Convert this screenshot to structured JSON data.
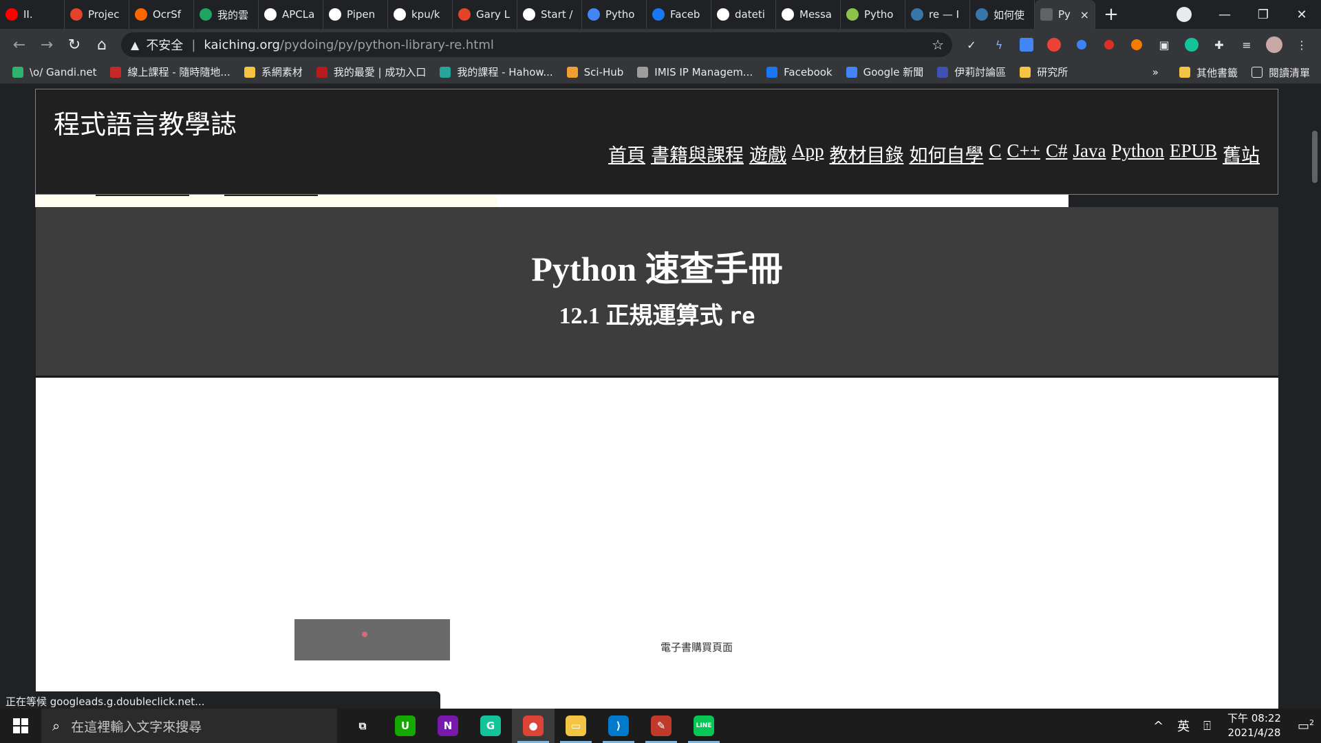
{
  "browser": {
    "tabs": [
      {
        "label": "II.",
        "icon": "youtube-icon",
        "color": "#ff0000"
      },
      {
        "label": "Projec",
        "icon": "gitlab-icon",
        "color": "#e24329"
      },
      {
        "label": "OcrSf",
        "icon": "sourceforge-icon",
        "color": "#ff6600"
      },
      {
        "label": "我的雲",
        "icon": "google-drive-icon",
        "color": "#1fa463"
      },
      {
        "label": "APCLa",
        "icon": "github-icon",
        "color": "#ffffff"
      },
      {
        "label": "Pipen",
        "icon": "medium-icon",
        "color": "#ffffff"
      },
      {
        "label": "kpu/k",
        "icon": "github-icon",
        "color": "#ffffff"
      },
      {
        "label": "Gary L",
        "icon": "gitlab-icon",
        "color": "#e24329"
      },
      {
        "label": "Start /",
        "icon": "start-icon",
        "color": "#ffffff"
      },
      {
        "label": "Pytho",
        "icon": "codegrepper-icon",
        "color": "#4285f4"
      },
      {
        "label": "Faceb",
        "icon": "facebook-icon",
        "color": "#1877f2"
      },
      {
        "label": "dateti",
        "icon": "google-icon",
        "color": "#ffffff"
      },
      {
        "label": "Messa",
        "icon": "google-icon",
        "color": "#ffffff"
      },
      {
        "label": "Pytho",
        "icon": "python-icon",
        "color": "#8bc34a"
      },
      {
        "label": "re — I",
        "icon": "python-icon",
        "color": "#3776ab"
      },
      {
        "label": "如何使",
        "icon": "python-icon",
        "color": "#3776ab"
      }
    ],
    "active_tab": {
      "label": "Py",
      "close": "×"
    },
    "new_tab": "+",
    "window": {
      "minimize": "—",
      "restore": "❐",
      "close": "✕"
    },
    "address": {
      "security_label": "不安全",
      "separator": "|",
      "host": "kaiching.org",
      "path": "/pydoing/py/python-library-re.html"
    },
    "bookmarks": [
      {
        "label": "\\o/ Gandi.net",
        "color": "#2fb26b"
      },
      {
        "label": "線上課程 - 隨時隨地...",
        "color": "#c62828"
      },
      {
        "label": "系網素材",
        "color": "#f6c342"
      },
      {
        "label": "我的最愛 | 成功入口",
        "color": "#b71c1c"
      },
      {
        "label": "我的課程 - Hahow...",
        "color": "#26a69a"
      },
      {
        "label": "Sci-Hub",
        "color": "#f0a030"
      },
      {
        "label": "IMIS IP Managem...",
        "color": "#9e9e9e"
      },
      {
        "label": "Facebook",
        "color": "#1877f2"
      },
      {
        "label": "Google 新聞",
        "color": "#4285f4"
      },
      {
        "label": "伊莉討論區",
        "color": "#3f51b5"
      },
      {
        "label": "研究所",
        "color": "#f6c342"
      }
    ],
    "bookmarks_more": "»",
    "other_bookmarks": "其他書籤",
    "reading_list": "閱讀清單",
    "status_text": "正在等候 googleads.g.doubleclick.net..."
  },
  "page": {
    "site_title": "程式語言教學誌",
    "nav": [
      "首頁",
      "書籍與課程",
      "遊戲",
      "App",
      "教材目錄",
      "如何自學",
      "C",
      "C++",
      "C#",
      "Java",
      "Python",
      "EPUB",
      "舊站"
    ],
    "hero_title": "Python 速查手冊",
    "hero_subtitle_prefix": "12.1 正規運算式 ",
    "hero_subtitle_code": "re",
    "ebook_text": "電子書購買頁面"
  },
  "taskbar": {
    "search_placeholder": "在這裡輸入文字來搜尋",
    "apps": [
      {
        "name": "task-view",
        "label": "⧉",
        "color": "transparent"
      },
      {
        "name": "upwork",
        "label": "U",
        "color": "#14a800"
      },
      {
        "name": "onenote",
        "label": "N",
        "color": "#7719aa"
      },
      {
        "name": "grammarly",
        "label": "G",
        "color": "#15c39a"
      },
      {
        "name": "chrome",
        "label": "●",
        "color": "#db4437"
      },
      {
        "name": "file-explorer",
        "label": "▭",
        "color": "#f4c542"
      },
      {
        "name": "vscode",
        "label": "⟩",
        "color": "#007acc"
      },
      {
        "name": "pen-app",
        "label": "✎",
        "color": "#c0392b"
      },
      {
        "name": "line",
        "label": "LINE",
        "color": "#06c755"
      }
    ],
    "tray": {
      "chevron": "^",
      "ime": "英",
      "ime_mode": "⍐",
      "time": "下午 08:22",
      "date": "2021/4/28",
      "notifications": "2"
    }
  }
}
